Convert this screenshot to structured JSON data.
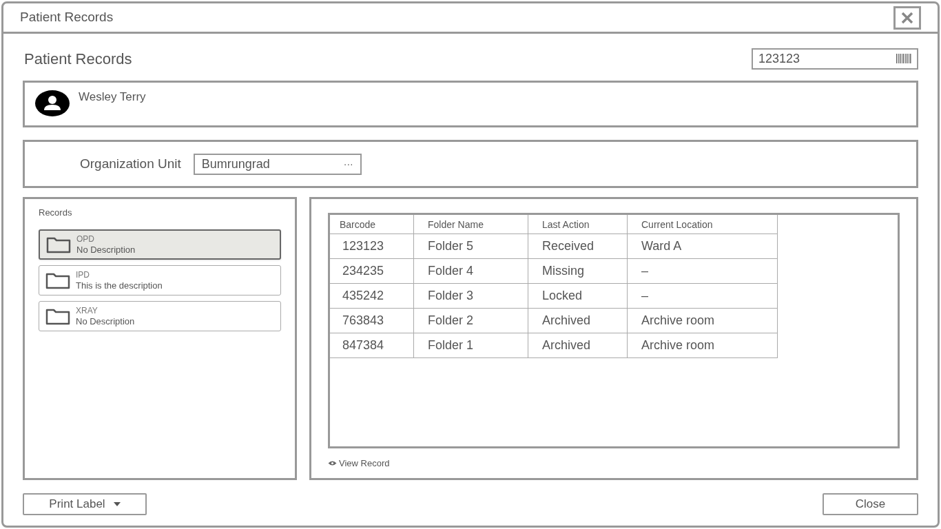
{
  "window": {
    "title": "Patient Records"
  },
  "heading": "Patient Records",
  "barcode_field": {
    "value": "123123"
  },
  "patient": {
    "name": "Wesley Terry"
  },
  "organization": {
    "label": "Organization Unit",
    "value": "Bumrungrad",
    "button": "···"
  },
  "records": {
    "title": "Records",
    "items": [
      {
        "name": "OPD",
        "description": "No Description",
        "selected": true
      },
      {
        "name": "IPD",
        "description": "This is the description",
        "selected": false
      },
      {
        "name": "XRAY",
        "description": "No Description",
        "selected": false
      }
    ]
  },
  "table": {
    "columns": [
      "Barcode",
      "Folder Name",
      "Last Action",
      "Current Location"
    ],
    "rows": [
      [
        "123123",
        "Folder 5",
        "Received",
        "Ward A"
      ],
      [
        "234235",
        "Folder 4",
        "Missing",
        "–"
      ],
      [
        "435242",
        "Folder 3",
        "Locked",
        "–"
      ],
      [
        "763843",
        "Folder 2",
        "Archived",
        "Archive room"
      ],
      [
        "847384",
        "Folder 1",
        "Archived",
        "Archive room"
      ]
    ]
  },
  "view_record": "View Record",
  "print_label": "Print Label",
  "close": "Close"
}
